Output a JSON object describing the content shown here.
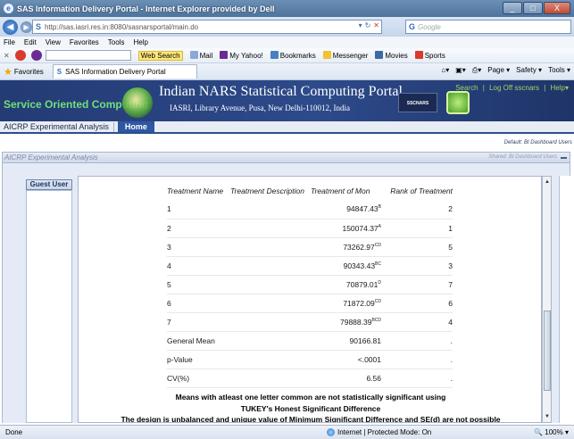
{
  "window": {
    "title": "SAS Information Delivery Portal - Internet Explorer provided by Dell",
    "buttons": {
      "minimize": "_",
      "maximize": "□",
      "close": "X"
    }
  },
  "address_bar": {
    "url": "http://sas.iasri.res.in:8080/sasnarsportal/main.do",
    "search_placeholder": "Google"
  },
  "menu": [
    "File",
    "Edit",
    "View",
    "Favorites",
    "Tools",
    "Help"
  ],
  "toolbar": {
    "web_search": "Web Search",
    "mail": "Mail",
    "my_yahoo": "My Yahoo!",
    "bookmarks": "Bookmarks",
    "messenger": "Messenger",
    "movies": "Movies",
    "sports": "Sports"
  },
  "favorites_bar": {
    "favorites_label": "Favorites",
    "tab_label": "SAS Information Delivery Portal",
    "commands": [
      "Page ▾",
      "Safety ▾",
      "Tools ▾"
    ]
  },
  "banner": {
    "left_title": "Service Oriented Computing",
    "portal_title": "Indian NARS Statistical Computing Portal",
    "portal_subtitle": "IASRI, Library Avenue, Pusa, New Delhi-110012, India",
    "links": [
      "Search",
      "|",
      "Log Off sscnars",
      "|",
      "Help▾"
    ],
    "logo_text": "SSCNARS"
  },
  "tabs": {
    "aicrp": "AICRP Experimental Analysis",
    "home": "Home"
  },
  "dashboard_label": "Default: BI Dashboard Users",
  "panel": {
    "title": "AICRP Experimental Analysis",
    "shared": "Shared: BI Dashboard Users",
    "guest_user": "Guest User"
  },
  "results": {
    "headers": [
      "Treatment Name",
      "Treatment Description",
      "Treatment of Mon",
      "Rank of Treatment"
    ],
    "rows": [
      {
        "name": "1",
        "value": "94847.43",
        "group": "B",
        "rank": "2"
      },
      {
        "name": "2",
        "value": "150074.37",
        "group": "A",
        "rank": "1"
      },
      {
        "name": "3",
        "value": "73262.97",
        "group": "CD",
        "rank": "5"
      },
      {
        "name": "4",
        "value": "90343.43",
        "group": "BC",
        "rank": "3"
      },
      {
        "name": "5",
        "value": "70879.01",
        "group": "D",
        "rank": "7"
      },
      {
        "name": "6",
        "value": "71872.09",
        "group": "CD",
        "rank": "6"
      },
      {
        "name": "7",
        "value": "79888.39",
        "group": "BCD",
        "rank": "4"
      }
    ],
    "summary": [
      {
        "name": "General Mean",
        "value": "90166.81",
        "rank": "."
      },
      {
        "name": "p-Value",
        "value": "<.0001",
        "rank": "."
      },
      {
        "name": "CV(%)",
        "value": "6.56",
        "rank": "."
      }
    ],
    "note1": "Means with atleast one letter common are not statistically significant using",
    "note2": "TUKEY's Honest Significant Difference",
    "note3": "The design is unbalanced and unique value of Minimum Significant Difference and SE(d) are not possible"
  },
  "status_bar": {
    "left": "Done",
    "zone": "Internet | Protected Mode: On",
    "zoom": "100%"
  }
}
